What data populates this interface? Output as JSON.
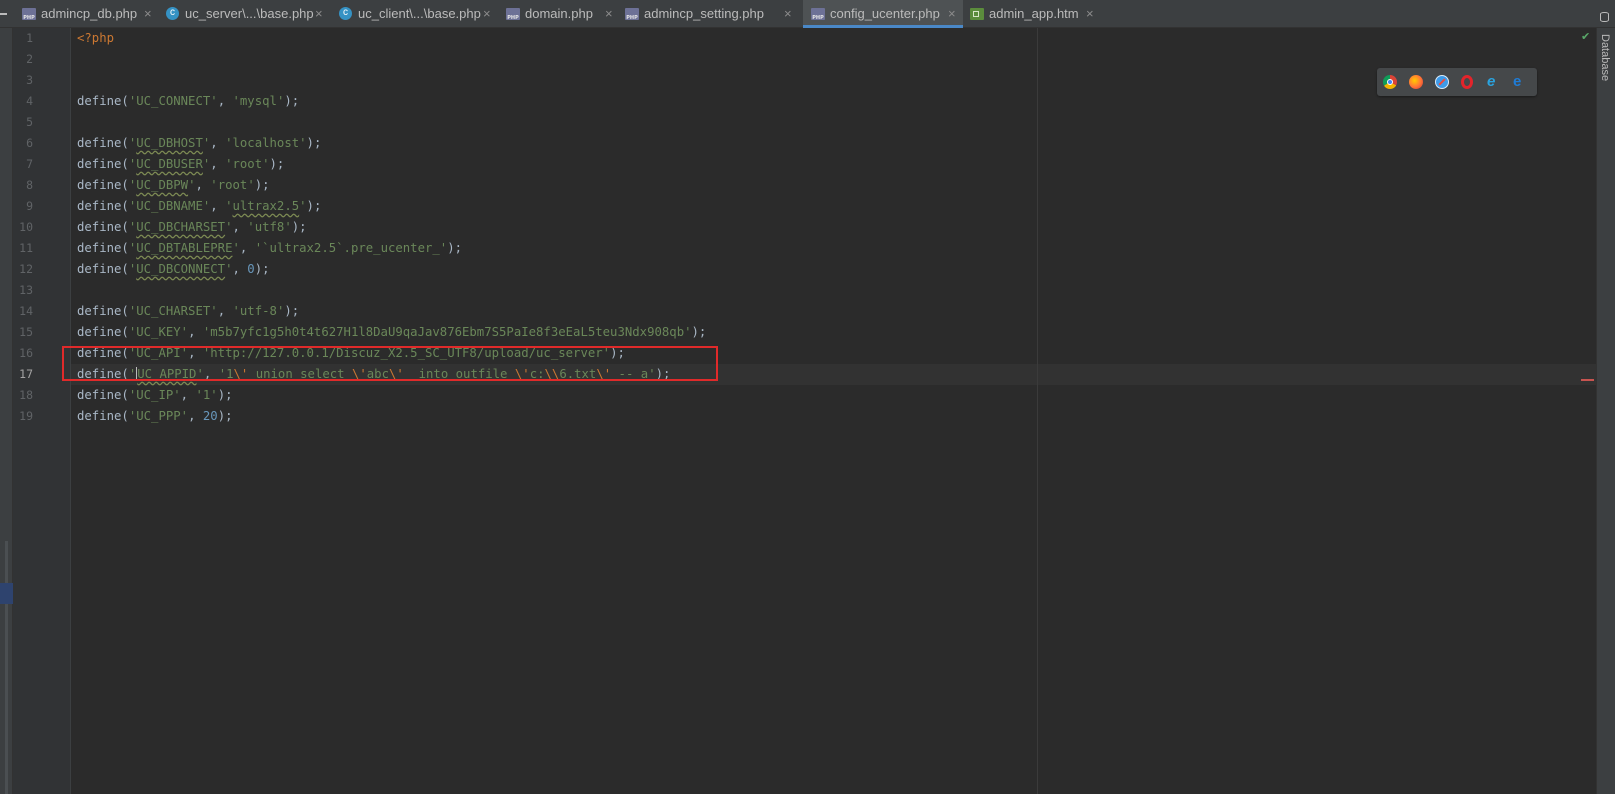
{
  "tabs": [
    {
      "label": "admincp_db.php",
      "icon": "php-file-icon",
      "active": false
    },
    {
      "label": "uc_server\\...\\base.php",
      "icon": "php-class-icon",
      "active": false
    },
    {
      "label": "uc_client\\...\\base.php",
      "icon": "php-class-icon",
      "active": false
    },
    {
      "label": "domain.php",
      "icon": "php-file-icon",
      "active": false
    },
    {
      "label": "admincp_setting.php",
      "icon": "php-file-icon",
      "active": false
    },
    {
      "label": "config_ucenter.php",
      "icon": "php-file-icon",
      "active": true
    },
    {
      "label": "admin_app.htm",
      "icon": "html-file-icon",
      "active": false
    }
  ],
  "close_glyph": "×",
  "line_numbers": [
    "1",
    "2",
    "3",
    "4",
    "5",
    "6",
    "7",
    "8",
    "9",
    "10",
    "11",
    "12",
    "13",
    "14",
    "15",
    "16",
    "17",
    "18",
    "19"
  ],
  "current_line": 17,
  "code": {
    "open_tag": "<?php",
    "define": "define",
    "l4": {
      "name": "UC_CONNECT",
      "value": "mysql"
    },
    "l6": {
      "name": "UC_DBHOST",
      "value": "localhost"
    },
    "l7": {
      "name": "UC_DBUSER",
      "value": "root"
    },
    "l8": {
      "name": "UC_DBPW",
      "value": "root"
    },
    "l9": {
      "name": "UC_DBNAME",
      "value": "ultrax2.5"
    },
    "l10": {
      "name": "UC_DBCHARSET",
      "value": "utf8"
    },
    "l11": {
      "name": "UC_DBTABLEPRE",
      "value": "`ultrax2.5`.pre_ucenter_"
    },
    "l12": {
      "name": "UC_DBCONNECT",
      "value": "0"
    },
    "l14": {
      "name": "UC_CHARSET",
      "value": "utf-8"
    },
    "l15": {
      "name": "UC_KEY",
      "value": "m5b7yfc1g5h0t4t627H1l8DaU9qaJav876Ebm7S5PaIe8f3eEaL5teu3Ndx908qb"
    },
    "l16": {
      "name": "UC_API",
      "value": "http://127.0.0.1/Discuz_X2.5_SC_UTF8/upload/uc_server"
    },
    "l17": {
      "name": "UC_APPID",
      "value_a": "1",
      "esc1": "\\'",
      "value_b": " union select ",
      "esc2": "\\'",
      "value_c": "abc",
      "esc3": "\\'",
      "value_d": "  into outfile ",
      "esc4": "\\'",
      "value_e": "c:",
      "esc5": "\\\\",
      "value_f": "6.txt",
      "esc6": "\\'",
      "value_g": " -- a"
    },
    "l18": {
      "name": "UC_IP",
      "value": "1"
    },
    "l19": {
      "name": "UC_PPP",
      "value": "20"
    }
  },
  "browsers": [
    "chrome-icon",
    "firefox-icon",
    "safari-icon",
    "opera-icon",
    "ie-icon",
    "edge-icon"
  ],
  "right_panel": {
    "label": "Database"
  },
  "colors": {
    "editor_bg": "#2b2b2b",
    "keyword": "#cc7832",
    "string": "#6a8759",
    "number": "#6897bb",
    "active_tab_underline": "#4a88c7",
    "highlight_box": "#e02a2a"
  }
}
